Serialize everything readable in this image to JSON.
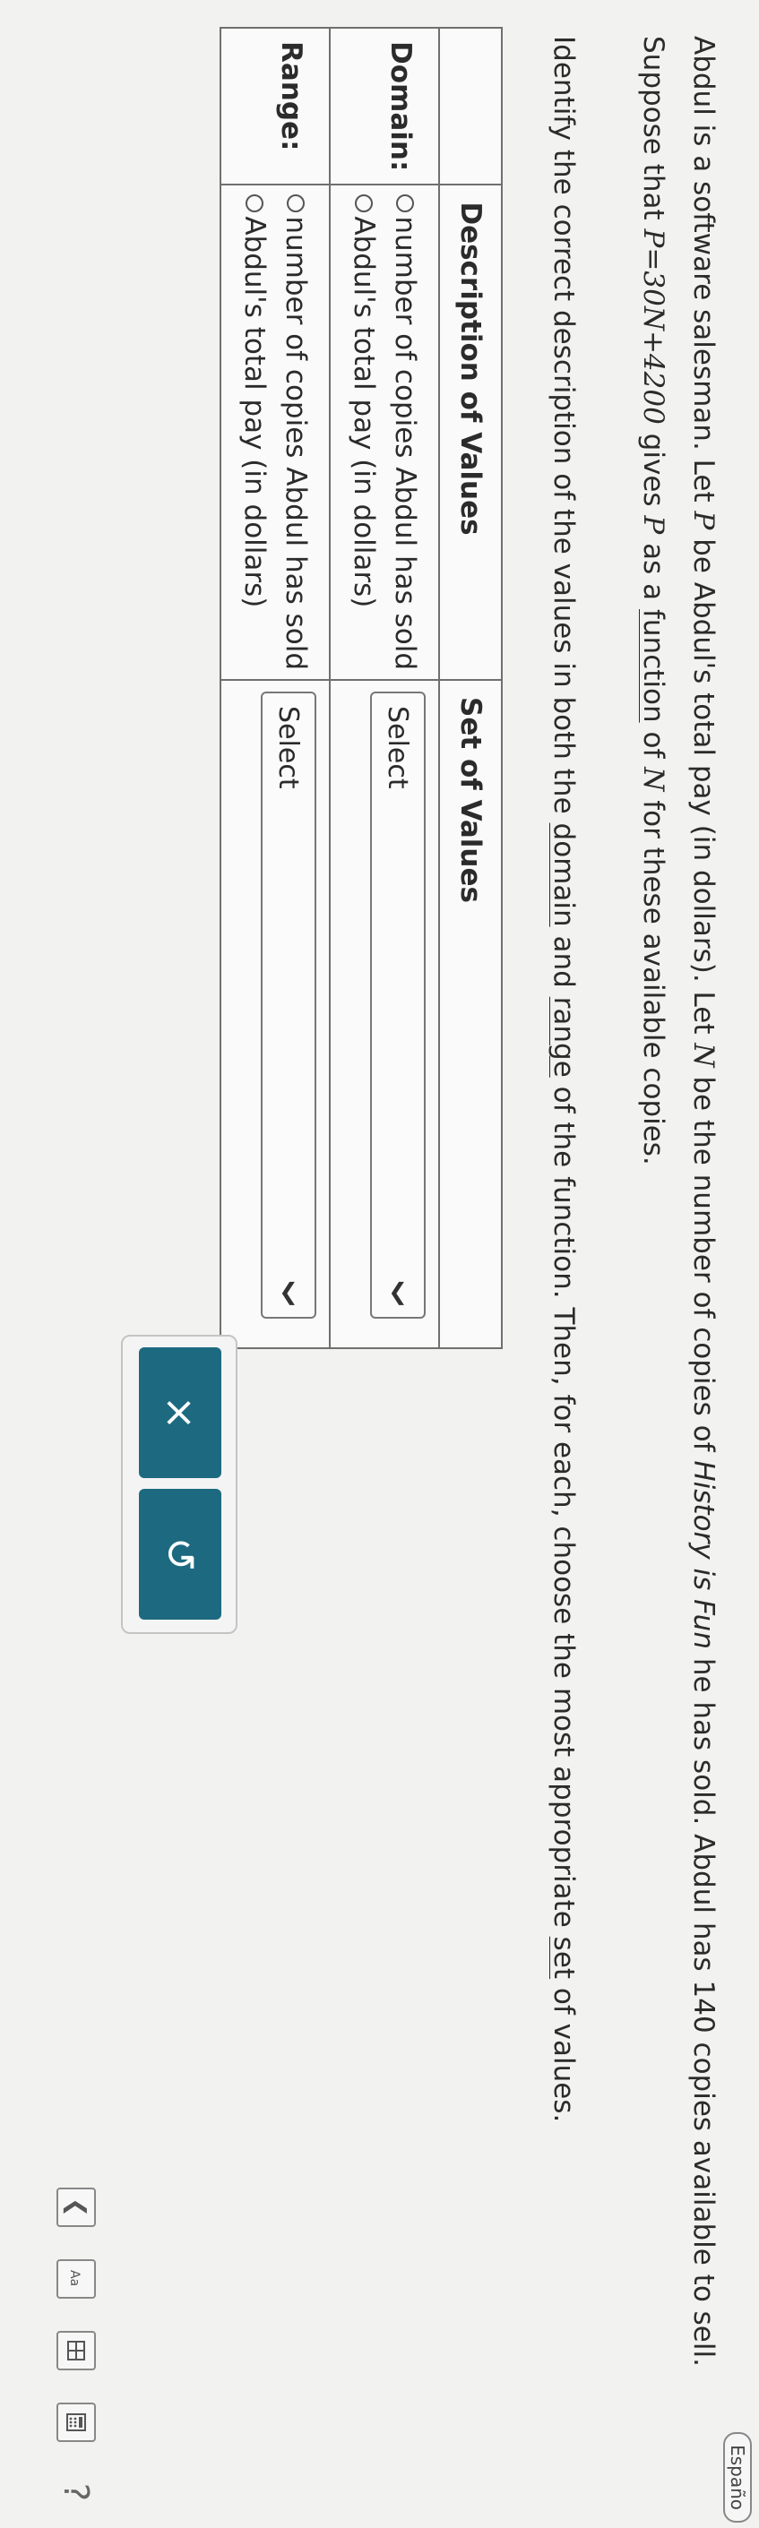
{
  "header": {
    "language_link": "Españo"
  },
  "problem": {
    "p1": "Abdul is a software salesman. Let ",
    "var_p": "P",
    "p2": " be Abdul's total pay (in dollars). Let ",
    "var_n": "N",
    "p3": " be the number of copies of ",
    "book_title": "History is Fun",
    "p4": " he has sold. Abdul has 140 copies available to sell. Suppose that ",
    "equation": "P=30N+4200",
    "p5": " gives ",
    "var_p2": "P",
    "p6": " as a ",
    "link_function": "function",
    "p7": " of ",
    "var_n2": "N",
    "p8": " for these available copies."
  },
  "instruction": {
    "i1": "Identify the correct description of the values in both the ",
    "link_domain": "domain",
    "i2": " and ",
    "link_range": "range",
    "i3": " of the function. Then, for each, choose the most appropriate ",
    "link_set": "set",
    "i4": " of values."
  },
  "table": {
    "header_description": "Description of Values",
    "header_set": "Set of Values",
    "rows": [
      {
        "label": "Domain:",
        "options": [
          "number of copies Abdul has sold",
          "Abdul's total pay (in dollars)"
        ],
        "select_placeholder": "Select"
      },
      {
        "label": "Range:",
        "options": [
          "number of copies Abdul has sold",
          "Abdul's total pay (in dollars)"
        ],
        "select_placeholder": "Select"
      }
    ]
  },
  "buttons": {
    "clear_symbol": "×",
    "undo_symbol": "↺"
  },
  "tools": {
    "help_symbol": "?"
  },
  "colors": {
    "button": "#1d6a80",
    "background": "#f2f2f0",
    "border": "#6f6f6f"
  }
}
